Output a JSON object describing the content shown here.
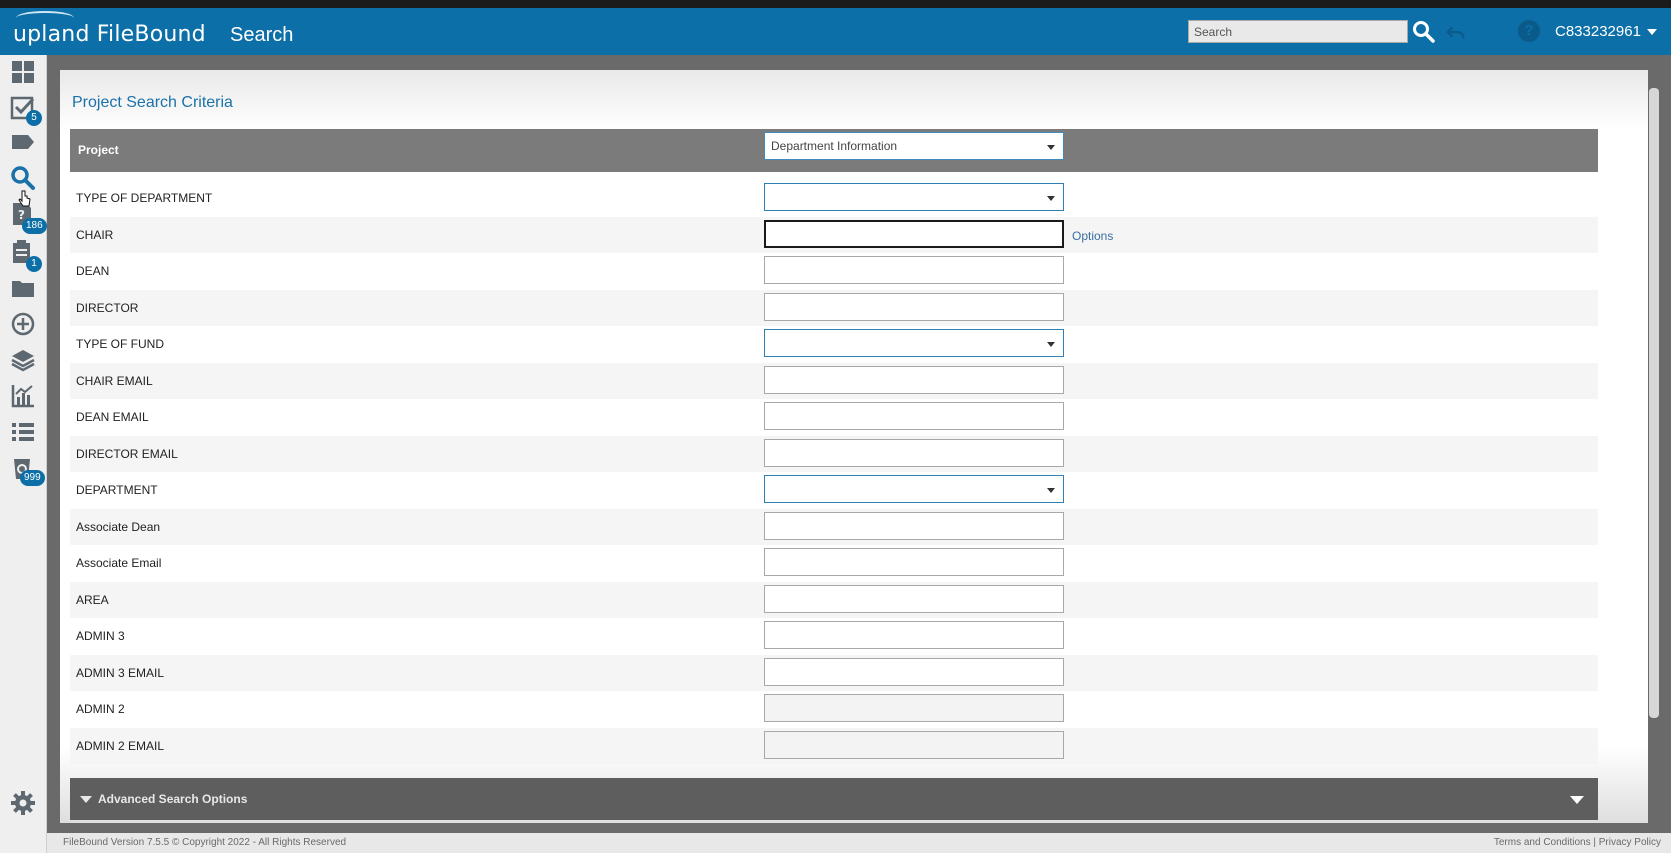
{
  "header": {
    "logo": "upland FileBound",
    "title": "Search",
    "search_placeholder": "Search",
    "user": "C833232961"
  },
  "sidebar": {
    "items": [
      {
        "icon": "dashboard-icon"
      },
      {
        "icon": "tasks-icon",
        "badge": "5"
      },
      {
        "icon": "tag-icon"
      },
      {
        "icon": "search-icon"
      },
      {
        "icon": "unassigned-icon",
        "badge": "186"
      },
      {
        "icon": "clipboard-icon",
        "badge": "1"
      },
      {
        "icon": "folder-icon"
      },
      {
        "icon": "add-icon"
      },
      {
        "icon": "layers-icon"
      },
      {
        "icon": "reports-icon"
      },
      {
        "icon": "list-icon"
      },
      {
        "icon": "recycle-icon",
        "badge": "999"
      },
      {
        "icon": "settings-icon"
      }
    ]
  },
  "panel": {
    "title": "Project Search Criteria",
    "project_label": "Project",
    "project_value": "Department Information"
  },
  "fields": [
    {
      "label": "TYPE OF DEPARTMENT",
      "type": "select"
    },
    {
      "label": "CHAIR",
      "type": "text",
      "focused": true,
      "options": "Options"
    },
    {
      "label": "DEAN",
      "type": "text"
    },
    {
      "label": "DIRECTOR",
      "type": "text"
    },
    {
      "label": "TYPE OF FUND",
      "type": "select"
    },
    {
      "label": "CHAIR EMAIL",
      "type": "text"
    },
    {
      "label": "DEAN EMAIL",
      "type": "text"
    },
    {
      "label": "DIRECTOR EMAIL",
      "type": "text"
    },
    {
      "label": "DEPARTMENT",
      "type": "select"
    },
    {
      "label": "Associate Dean",
      "type": "text"
    },
    {
      "label": "Associate Email",
      "type": "text"
    },
    {
      "label": "AREA",
      "type": "text"
    },
    {
      "label": "ADMIN 3",
      "type": "text"
    },
    {
      "label": "ADMIN 3 EMAIL",
      "type": "text"
    },
    {
      "label": "ADMIN 2",
      "type": "text",
      "disabled": true
    },
    {
      "label": "ADMIN 2 EMAIL",
      "type": "text",
      "disabled": true
    }
  ],
  "advanced": {
    "label": "Advanced Search Options"
  },
  "footer": {
    "version": "FileBound Version 7.5.5 © Copyright 2022 - All Rights Reserved",
    "terms": "Terms and Conditions",
    "sep": "|",
    "privacy": "Privacy Policy"
  },
  "colors": {
    "header": "#0d6fa8",
    "accent": "#1a72a8",
    "bar": "#7b7b7b"
  }
}
